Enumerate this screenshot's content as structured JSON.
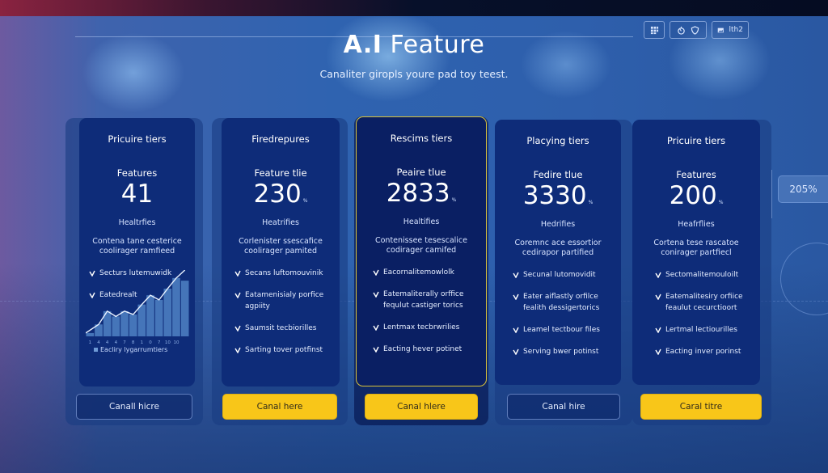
{
  "header": {
    "title_bold": "A.I",
    "title_light": "Feature",
    "subtitle": "Canaliter giropls youre pad toy teest."
  },
  "toolbar": {
    "groups": [
      {
        "icons": [
          "grid-icon"
        ]
      },
      {
        "icons": [
          "timer-icon",
          "shield-icon"
        ]
      },
      {
        "icons": [
          "image-icon"
        ],
        "label": "lth2"
      }
    ]
  },
  "side_badge": {
    "value": "205%"
  },
  "cards": [
    {
      "title": "Pricuire tiers",
      "label": "Features",
      "number": "41",
      "unit": "",
      "sub": "Healtrfies",
      "desc": [
        "Contena tane cesterice",
        "coolirager ramfieed"
      ],
      "features": [
        "Secturs lutemuwidk",
        "Eatedrealt"
      ],
      "cta": "Canall hicre",
      "cta_style": "outline"
    },
    {
      "title": "Firedrepures",
      "label": "Feature tlie",
      "number": "230",
      "unit": "%",
      "sub": "Heatrifies",
      "desc": [
        "Corlenister ssescafice",
        "coolirager pamited"
      ],
      "features": [
        "Secans luftomouvinik",
        "Eatamenisialy porfice agpiity",
        "Saumsit tecbiorilles",
        "Sarting tover potfinst"
      ],
      "cta": "Canal here",
      "cta_style": "yellow"
    },
    {
      "title": "Rescims tiers",
      "label": "Peaire tlue",
      "number": "2833",
      "unit": "%",
      "sub": "Healtifies",
      "desc": [
        "Contenissee tesescalice",
        "codirager camifed"
      ],
      "features": [
        "Eacornalitemowlolk",
        "Eatemaliterally orffice fequlut castiger torics",
        "Lentmax tecbrwrilies",
        "Eacting hever potinet"
      ],
      "cta": "Canal hlere",
      "cta_style": "yellow"
    },
    {
      "title": "Placying tiers",
      "label": "Fedire tlue",
      "number": "3330",
      "unit": "%",
      "sub": "Hedrifies",
      "desc": [
        "Coremnc ace essortior",
        "cedirapor partified"
      ],
      "features": [
        "Secunal lutomovidit",
        "Eater aiflastly orfilce fealith dessigertorics",
        "Leamel tectbour files",
        "Serving bwer potinst"
      ],
      "cta": "Canal hire",
      "cta_style": "outline"
    },
    {
      "title": "Pricuire tiers",
      "label": "Features",
      "number": "200",
      "unit": "%",
      "sub": "Heafrflies",
      "desc": [
        "Cortena tese rascatoe",
        "conirager partfiecl"
      ],
      "features": [
        "Sectomalitemouloilt",
        "Eatemalitesiry orfiice feaulut cecurctioort",
        "Lertmal lectiourilles",
        "Eacting inver porinst"
      ],
      "cta": "Caral titre",
      "cta_style": "yellow"
    }
  ],
  "chart_data": {
    "type": "area",
    "title": "",
    "x": [
      1,
      2,
      3,
      4,
      5,
      6,
      7,
      8,
      9,
      10,
      11,
      12
    ],
    "tick_labels": [
      "1",
      "4",
      "4",
      "4",
      "7",
      "8",
      "1",
      "0",
      "7",
      "10",
      "10",
      ""
    ],
    "series": [
      {
        "name": "Eacliry lygarrumtiers",
        "values": [
          5,
          18,
          38,
          30,
          38,
          33,
          48,
          62,
          55,
          72,
          88,
          84
        ]
      }
    ],
    "line_values": [
      5,
      18,
      38,
      30,
      38,
      33,
      48,
      62,
      55,
      72,
      88,
      100
    ],
    "ylim": [
      0,
      100
    ],
    "xlabel": "",
    "ylabel": "",
    "legend": "bottom",
    "grid": false
  }
}
